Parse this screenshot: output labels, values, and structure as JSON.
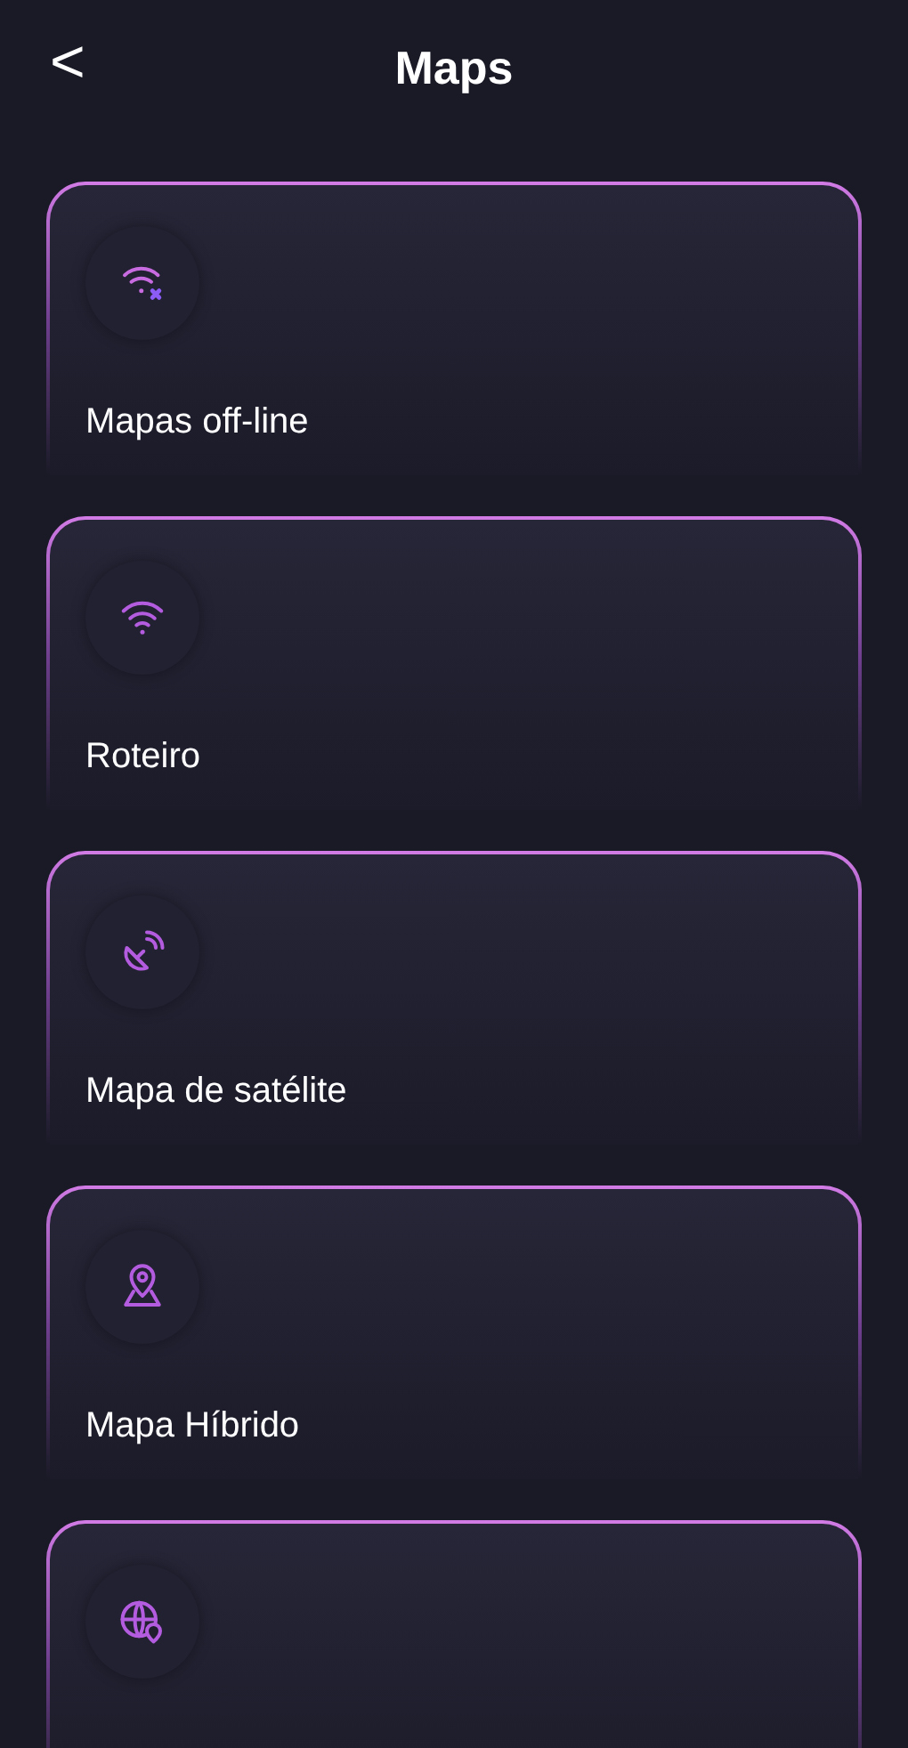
{
  "header": {
    "back": "<",
    "title": "Maps"
  },
  "cards": [
    {
      "kind": "wifi-off",
      "label": "Mapas off-line"
    },
    {
      "kind": "wifi",
      "label": "Roteiro"
    },
    {
      "kind": "satellite",
      "label": "Mapa de satélite"
    },
    {
      "kind": "map-pin",
      "label": "Mapa Híbrido"
    },
    {
      "kind": "globe-pin"
    }
  ]
}
